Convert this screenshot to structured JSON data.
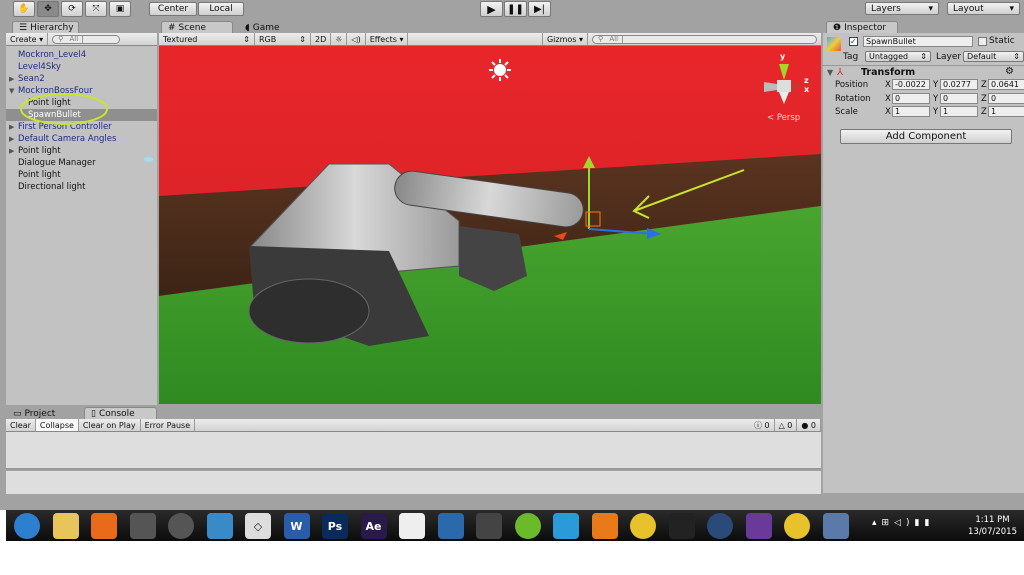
{
  "toolbar": {
    "tools": [
      "hand-tool",
      "move-tool",
      "rotate-tool",
      "scale-tool",
      "rect-tool"
    ],
    "pivot": "Center",
    "space": "Local",
    "layers": "Layers",
    "layout": "Layout"
  },
  "hierarchy": {
    "tab": "Hierarchy",
    "create": "Create",
    "search_placeholder": "All",
    "items": [
      {
        "label": "Mockron_Level4",
        "arrow": "",
        "indent": 0,
        "color": "blue"
      },
      {
        "label": "Level4Sky",
        "arrow": "",
        "indent": 0,
        "color": "blue"
      },
      {
        "label": "Sean2",
        "arrow": "▶",
        "indent": 0,
        "color": "blue"
      },
      {
        "label": "MockronBossFour",
        "arrow": "▼",
        "indent": 0,
        "color": "blue"
      },
      {
        "label": "Point light",
        "arrow": "",
        "indent": 1,
        "color": "black"
      },
      {
        "label": "SpawnBullet",
        "arrow": "",
        "indent": 1,
        "color": "black",
        "selected": true
      },
      {
        "label": "First Person Controller",
        "arrow": "▶",
        "indent": 0,
        "color": "blue"
      },
      {
        "label": "Default Camera Angles",
        "arrow": "▶",
        "indent": 0,
        "color": "blue"
      },
      {
        "label": "Point light",
        "arrow": "▶",
        "indent": 0,
        "color": "black"
      },
      {
        "label": "Dialogue Manager",
        "arrow": "",
        "indent": 0,
        "color": "black"
      },
      {
        "label": "Point light",
        "arrow": "",
        "indent": 0,
        "color": "black"
      },
      {
        "label": "Directional light",
        "arrow": "",
        "indent": 0,
        "color": "black"
      }
    ]
  },
  "scene": {
    "tab_scene": "Scene",
    "tab_game": "Game",
    "shading": "Textured",
    "render_mode": "RGB",
    "mode_2d": "2D",
    "effects": "Effects",
    "gizmos": "Gizmos",
    "search_placeholder": "All",
    "persp": "Persp",
    "axis_y": "y",
    "axis_z": "z",
    "axis_x": "x"
  },
  "inspector": {
    "tab": "Inspector",
    "name": "SpawnBullet",
    "static": "Static",
    "tag_label": "Tag",
    "tag": "Untagged",
    "layer_label": "Layer",
    "layer": "Default",
    "component": "Transform",
    "rows": [
      {
        "label": "Position",
        "x": "-0.0022",
        "y": "0.0277",
        "z": "0.0641"
      },
      {
        "label": "Rotation",
        "x": "0",
        "y": "0",
        "z": "0"
      },
      {
        "label": "Scale",
        "x": "1",
        "y": "1",
        "z": "1"
      }
    ],
    "add_component": "Add Component"
  },
  "console": {
    "tab_project": "Project",
    "tab_console": "Console",
    "buttons": [
      "Clear",
      "Collapse",
      "Clear on Play",
      "Error Pause"
    ],
    "info_count": "0",
    "warn_count": "0",
    "error_count": "0"
  },
  "taskbar": {
    "apps": [
      "windows-start",
      "file-explorer",
      "media-player",
      "app-feather",
      "app-7",
      "webcam",
      "unity",
      "word",
      "photoshop",
      "after-effects",
      "zbrush",
      "media-play",
      "app-x",
      "utorrent",
      "skype",
      "app-blocks",
      "chrome",
      "final-hours",
      "steam",
      "visual-studio",
      "chrome",
      "app-tray"
    ],
    "labels": {
      "word": "W",
      "photoshop": "Ps",
      "after-effects": "Ae"
    },
    "time": "1:11 PM",
    "date": "13/07/2015"
  },
  "colors": {
    "sky": "#e8262a",
    "ground": "#3f9c2c",
    "selection": "#8f8f8f",
    "annotation": "#c8e62a"
  }
}
